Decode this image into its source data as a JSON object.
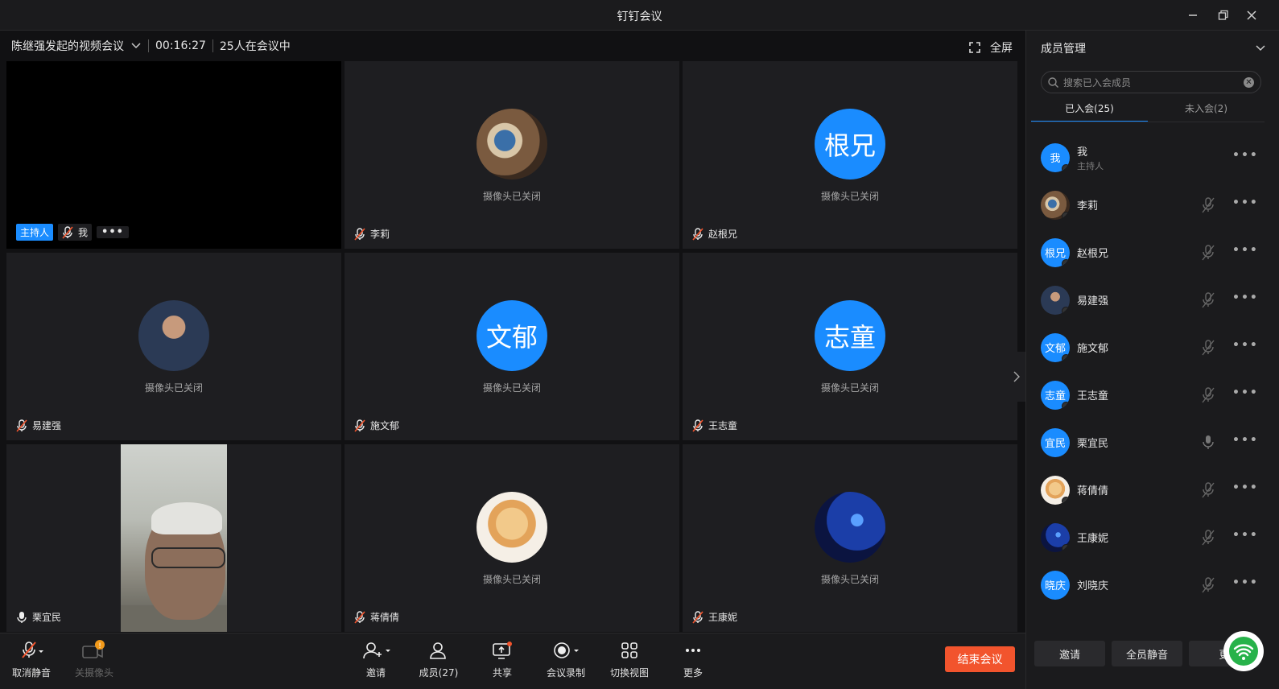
{
  "window": {
    "title": "钉钉会议"
  },
  "meeting": {
    "title": "陈继强发起的视频会议",
    "duration": "00:16:27",
    "count": "25人在会议中",
    "fullscreen_label": "全屏"
  },
  "camera_off_label": "摄像头已关闭",
  "tiles": [
    {
      "name": "我",
      "host_badge": "主持人"
    },
    {
      "name": "李莉"
    },
    {
      "name": "赵根兄",
      "avatar_text": "根兄"
    },
    {
      "name": "易建强"
    },
    {
      "name": "施文郁",
      "avatar_text": "文郁"
    },
    {
      "name": "王志童",
      "avatar_text": "志童"
    },
    {
      "name": "栗宜民"
    },
    {
      "name": "蒋倩倩"
    },
    {
      "name": "王康妮"
    }
  ],
  "toolbar": {
    "unmute": "取消静音",
    "camera": "关摄像头",
    "invite": "邀请",
    "members": "成员(27)",
    "share": "共享",
    "record": "会议录制",
    "switch_view": "切换视图",
    "more": "更多",
    "end": "结束会议"
  },
  "panel": {
    "title": "成员管理",
    "search_placeholder": "搜索已入会成员",
    "tab_joined": "已入会(25)",
    "tab_not_joined": "未入会(2)",
    "members": [
      {
        "name": "我",
        "sub": "主持人",
        "avatar": "我"
      },
      {
        "name": "李莉",
        "avatar": ""
      },
      {
        "name": "赵根兄",
        "avatar": "根兄"
      },
      {
        "name": "易建强",
        "avatar": ""
      },
      {
        "name": "施文郁",
        "avatar": "文郁"
      },
      {
        "name": "王志童",
        "avatar": "志童"
      },
      {
        "name": "栗宜民",
        "avatar": "宜民"
      },
      {
        "name": "蒋倩倩",
        "avatar": ""
      },
      {
        "name": "王康妮",
        "avatar": ""
      },
      {
        "name": "刘晓庆",
        "avatar": "晓庆"
      }
    ],
    "btn_invite": "邀请",
    "btn_mute_all": "全员静音",
    "btn_more": "更"
  },
  "colors": {
    "accent": "#1a8cff",
    "end": "#f2542d",
    "bg": "#111113",
    "tile": "#1e1e21"
  }
}
